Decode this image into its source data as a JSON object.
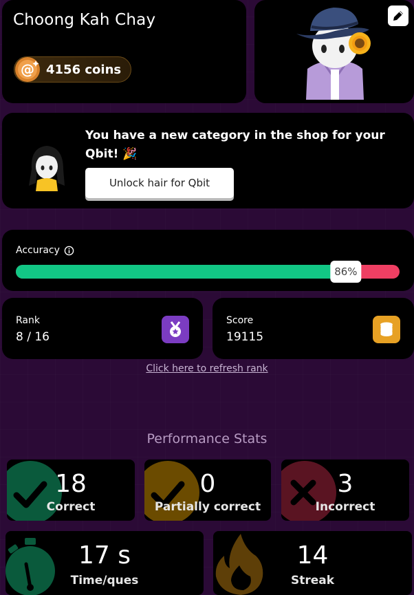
{
  "profile": {
    "name": "Choong Kah Chay",
    "coins": "4156 coins"
  },
  "avatar": {
    "edit_icon": "pencil-icon"
  },
  "shop": {
    "message": "You have a new category in the shop for your Qbit! 🎉",
    "button_label": "Unlock hair for Qbit"
  },
  "accuracy": {
    "label": "Accuracy",
    "value_text": "86%",
    "percent": 86,
    "colors": {
      "fill": "#12c785",
      "remaining": "#ef3f63"
    }
  },
  "rank": {
    "label": "Rank",
    "value": "8 / 16",
    "icon": "medal-icon"
  },
  "score": {
    "label": "Score",
    "value": "19115",
    "icon": "coins-stack-icon"
  },
  "refresh_link": "Click here to refresh rank",
  "performance": {
    "title": "Performance Stats",
    "correct": {
      "value": "18",
      "label": "Correct",
      "icon": "check-icon",
      "color": "#0a5a3c"
    },
    "partial": {
      "value": "0",
      "label": "Partially correct",
      "icon": "check-icon",
      "color": "#6b4b00"
    },
    "incorrect": {
      "value": "3",
      "label": "Incorrect",
      "icon": "cross-icon",
      "color": "#5a1422"
    },
    "time": {
      "value": "17 s",
      "label": "Time/ques",
      "icon": "stopwatch-icon",
      "color": "#0a5a3c"
    },
    "streak": {
      "value": "14",
      "label": "Streak",
      "icon": "flame-icon",
      "color": "#5e3f08"
    }
  }
}
